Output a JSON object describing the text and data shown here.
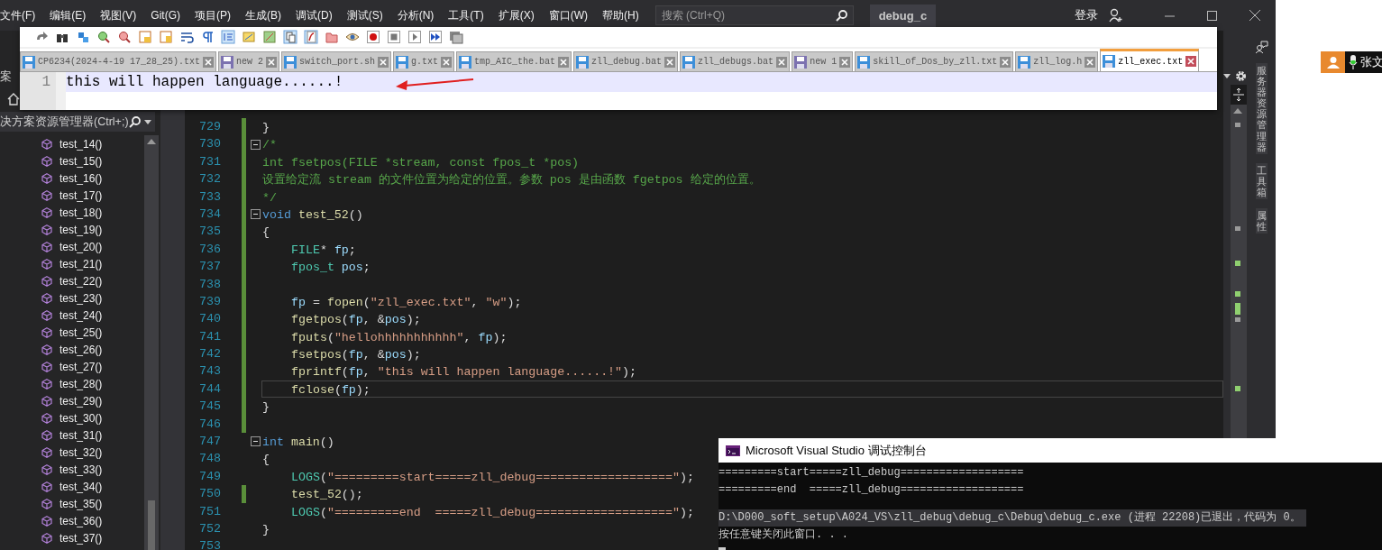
{
  "ide": {
    "menu": [
      "文件(F)",
      "编辑(E)",
      "视图(V)",
      "Git(G)",
      "项目(P)",
      "生成(B)",
      "调试(D)",
      "测试(S)",
      "分析(N)",
      "工具(T)",
      "扩展(X)",
      "窗口(W)",
      "帮助(H)"
    ],
    "search": {
      "placeholder": "搜索 (Ctrl+Q)"
    },
    "solution_name": "debug_c",
    "sign_in": "登录"
  },
  "solution_explorer": {
    "tab_label": "案",
    "search": {
      "placeholder": "决方案资源管理器(Ctrl+;)"
    },
    "items": [
      "test_14()",
      "test_15()",
      "test_16()",
      "test_17()",
      "test_18()",
      "test_19()",
      "test_20()",
      "test_21()",
      "test_22()",
      "test_23()",
      "test_24()",
      "test_25()",
      "test_26()",
      "test_27()",
      "test_28()",
      "test_29()",
      "test_30()",
      "test_31()",
      "test_32()",
      "test_33()",
      "test_34()",
      "test_35()",
      "test_36()",
      "test_37()"
    ]
  },
  "editor": {
    "lines": [
      {
        "number": "729",
        "changed": true,
        "fold": false,
        "current": false,
        "indented": false,
        "tokens": [
          {
            "kind": "plain",
            "text": "}"
          }
        ]
      },
      {
        "number": "730",
        "changed": true,
        "fold": true,
        "current": false,
        "indented": false,
        "tokens": [
          {
            "kind": "comment",
            "text": "/*"
          }
        ]
      },
      {
        "number": "731",
        "changed": true,
        "fold": false,
        "current": false,
        "indented": false,
        "tokens": [
          {
            "kind": "comment",
            "text": "int fsetpos(FILE *stream, const fpos_t *pos)"
          }
        ]
      },
      {
        "number": "732",
        "changed": true,
        "fold": false,
        "current": false,
        "indented": false,
        "tokens": [
          {
            "kind": "comment",
            "text": "设置给定流 stream 的文件位置为给定的位置。参数 pos 是由函数 fgetpos 给定的位置。"
          }
        ]
      },
      {
        "number": "733",
        "changed": true,
        "fold": false,
        "current": false,
        "indented": false,
        "tokens": [
          {
            "kind": "comment",
            "text": "*/"
          }
        ]
      },
      {
        "number": "734",
        "changed": true,
        "fold": true,
        "current": false,
        "indented": false,
        "tokens": [
          {
            "kind": "keyword",
            "text": "void "
          },
          {
            "kind": "function",
            "text": "test_52"
          },
          {
            "kind": "plain",
            "text": "()"
          }
        ]
      },
      {
        "number": "735",
        "changed": true,
        "fold": false,
        "current": false,
        "indented": false,
        "tokens": [
          {
            "kind": "plain",
            "text": "{"
          }
        ]
      },
      {
        "number": "736",
        "changed": true,
        "fold": false,
        "current": false,
        "indented": true,
        "tokens": [
          {
            "kind": "type",
            "text": "FILE"
          },
          {
            "kind": "plain",
            "text": "* "
          },
          {
            "kind": "variable",
            "text": "fp"
          },
          {
            "kind": "plain",
            "text": ";"
          }
        ]
      },
      {
        "number": "737",
        "changed": true,
        "fold": false,
        "current": false,
        "indented": true,
        "tokens": [
          {
            "kind": "type",
            "text": "fpos_t "
          },
          {
            "kind": "variable",
            "text": "pos"
          },
          {
            "kind": "plain",
            "text": ";"
          }
        ]
      },
      {
        "number": "738",
        "changed": true,
        "fold": false,
        "current": false,
        "indented": false
      },
      {
        "number": "739",
        "changed": true,
        "fold": false,
        "current": false,
        "indented": true,
        "tokens": [
          {
            "kind": "variable",
            "text": "fp"
          },
          {
            "kind": "plain",
            "text": " = "
          },
          {
            "kind": "function",
            "text": "fopen"
          },
          {
            "kind": "plain",
            "text": "("
          },
          {
            "kind": "string",
            "text": "\"zll_exec.txt\""
          },
          {
            "kind": "plain",
            "text": ", "
          },
          {
            "kind": "string",
            "text": "\"w\""
          },
          {
            "kind": "plain",
            "text": ");"
          }
        ]
      },
      {
        "number": "740",
        "changed": true,
        "fold": false,
        "current": false,
        "indented": true,
        "tokens": [
          {
            "kind": "function",
            "text": "fgetpos"
          },
          {
            "kind": "plain",
            "text": "("
          },
          {
            "kind": "variable",
            "text": "fp"
          },
          {
            "kind": "plain",
            "text": ", &"
          },
          {
            "kind": "variable",
            "text": "pos"
          },
          {
            "kind": "plain",
            "text": ");"
          }
        ]
      },
      {
        "number": "741",
        "changed": true,
        "fold": false,
        "current": false,
        "indented": true,
        "tokens": [
          {
            "kind": "function",
            "text": "fputs"
          },
          {
            "kind": "plain",
            "text": "("
          },
          {
            "kind": "string",
            "text": "\"hellohhhhhhhhhhh\""
          },
          {
            "kind": "plain",
            "text": ", "
          },
          {
            "kind": "variable",
            "text": "fp"
          },
          {
            "kind": "plain",
            "text": ");"
          }
        ]
      },
      {
        "number": "742",
        "changed": true,
        "fold": false,
        "current": false,
        "indented": true,
        "tokens": [
          {
            "kind": "function",
            "text": "fsetpos"
          },
          {
            "kind": "plain",
            "text": "("
          },
          {
            "kind": "variable",
            "text": "fp"
          },
          {
            "kind": "plain",
            "text": ", &"
          },
          {
            "kind": "variable",
            "text": "pos"
          },
          {
            "kind": "plain",
            "text": ");"
          }
        ]
      },
      {
        "number": "743",
        "changed": true,
        "fold": false,
        "current": false,
        "indented": true,
        "tokens": [
          {
            "kind": "function",
            "text": "fprintf"
          },
          {
            "kind": "plain",
            "text": "("
          },
          {
            "kind": "variable",
            "text": "fp"
          },
          {
            "kind": "plain",
            "text": ", "
          },
          {
            "kind": "string",
            "text": "\"this will happen language......!\""
          },
          {
            "kind": "plain",
            "text": ");"
          }
        ]
      },
      {
        "number": "744",
        "changed": true,
        "fold": false,
        "current": true,
        "indented": true,
        "tokens": [
          {
            "kind": "function",
            "text": "fclose"
          },
          {
            "kind": "plain",
            "text": "("
          },
          {
            "kind": "variable",
            "text": "fp"
          },
          {
            "kind": "plain",
            "text": ");"
          }
        ]
      },
      {
        "number": "745",
        "changed": true,
        "fold": false,
        "current": false,
        "indented": false,
        "tokens": [
          {
            "kind": "plain",
            "text": "}"
          }
        ]
      },
      {
        "number": "746",
        "changed": true,
        "fold": false,
        "current": false,
        "indented": false
      },
      {
        "number": "747",
        "changed": false,
        "fold": true,
        "current": false,
        "indented": false,
        "tokens": [
          {
            "kind": "keyword",
            "text": "int "
          },
          {
            "kind": "function",
            "text": "main"
          },
          {
            "kind": "plain",
            "text": "()"
          }
        ]
      },
      {
        "number": "748",
        "changed": false,
        "fold": false,
        "current": false,
        "indented": false,
        "tokens": [
          {
            "kind": "plain",
            "text": "{"
          }
        ]
      },
      {
        "number": "749",
        "changed": false,
        "fold": false,
        "current": false,
        "indented": true,
        "tokens": [
          {
            "kind": "macro",
            "text": "LOGS"
          },
          {
            "kind": "plain",
            "text": "("
          },
          {
            "kind": "string",
            "text": "\"=========start=====zll_debug===================\""
          },
          {
            "kind": "plain",
            "text": ");"
          }
        ]
      },
      {
        "number": "750",
        "changed": true,
        "fold": false,
        "current": false,
        "indented": true,
        "tokens": [
          {
            "kind": "function",
            "text": "test_52"
          },
          {
            "kind": "plain",
            "text": "();"
          }
        ]
      },
      {
        "number": "751",
        "changed": false,
        "fold": false,
        "current": false,
        "indented": true,
        "tokens": [
          {
            "kind": "macro",
            "text": "LOGS"
          },
          {
            "kind": "plain",
            "text": "("
          },
          {
            "kind": "string",
            "text": "\"=========end  =====zll_debug===================\""
          },
          {
            "kind": "plain",
            "text": ");"
          }
        ]
      },
      {
        "number": "752",
        "changed": false,
        "fold": false,
        "current": false,
        "indented": false,
        "tokens": [
          {
            "kind": "plain",
            "text": "}"
          }
        ]
      },
      {
        "number": "753",
        "changed": false,
        "fold": false,
        "current": false,
        "indented": false
      }
    ]
  },
  "tool_tabs": [
    "服务器资源管理器",
    "工具箱",
    "属性"
  ],
  "notepad": {
    "tabs": [
      {
        "label": "CP6234(2024-4-19 17_28_25).txt",
        "selected": false,
        "color": "#3d8fd9"
      },
      {
        "label": "new 2",
        "selected": false,
        "color": "#7c72b0"
      },
      {
        "label": "switch_port.sh",
        "selected": false,
        "color": "#3d8fd9"
      },
      {
        "label": "g.txt",
        "selected": false,
        "color": "#3d8fd9"
      },
      {
        "label": "tmp_AIC_the.bat",
        "selected": false,
        "color": "#3d8fd9"
      },
      {
        "label": "zll_debug.bat",
        "selected": false,
        "color": "#3d8fd9"
      },
      {
        "label": "zll_debugs.bat",
        "selected": false,
        "color": "#3d8fd9"
      },
      {
        "label": "new 1",
        "selected": false,
        "color": "#7c72b0"
      },
      {
        "label": "skill_of_Dos_by_zll.txt",
        "selected": false,
        "color": "#3d8fd9"
      },
      {
        "label": "zll_log.h",
        "selected": false,
        "color": "#3d8fd9"
      },
      {
        "label": "zll_exec.txt",
        "selected": true,
        "color": "#3d8fd9"
      }
    ],
    "lines": [
      {
        "number": "1",
        "text": "this will happen language......!",
        "current": true
      }
    ]
  },
  "console": {
    "title": "Microsoft Visual Studio 调试控制台",
    "lines": [
      {
        "text": "=========start=====zll_debug===================",
        "gap_before": false
      },
      {
        "text": "=========end  =====zll_debug===================",
        "gap_before": false
      },
      {
        "text": "D:\\D000_soft_setup\\A024_VS\\zll_debug\\debug_c\\Debug\\debug_c.exe (进程 22208)已退出，代码为 0。",
        "gap_before": true
      },
      {
        "text": "按任意键关闭此窗口. . .",
        "gap_before": false
      }
    ]
  },
  "user": {
    "name": "张文"
  }
}
